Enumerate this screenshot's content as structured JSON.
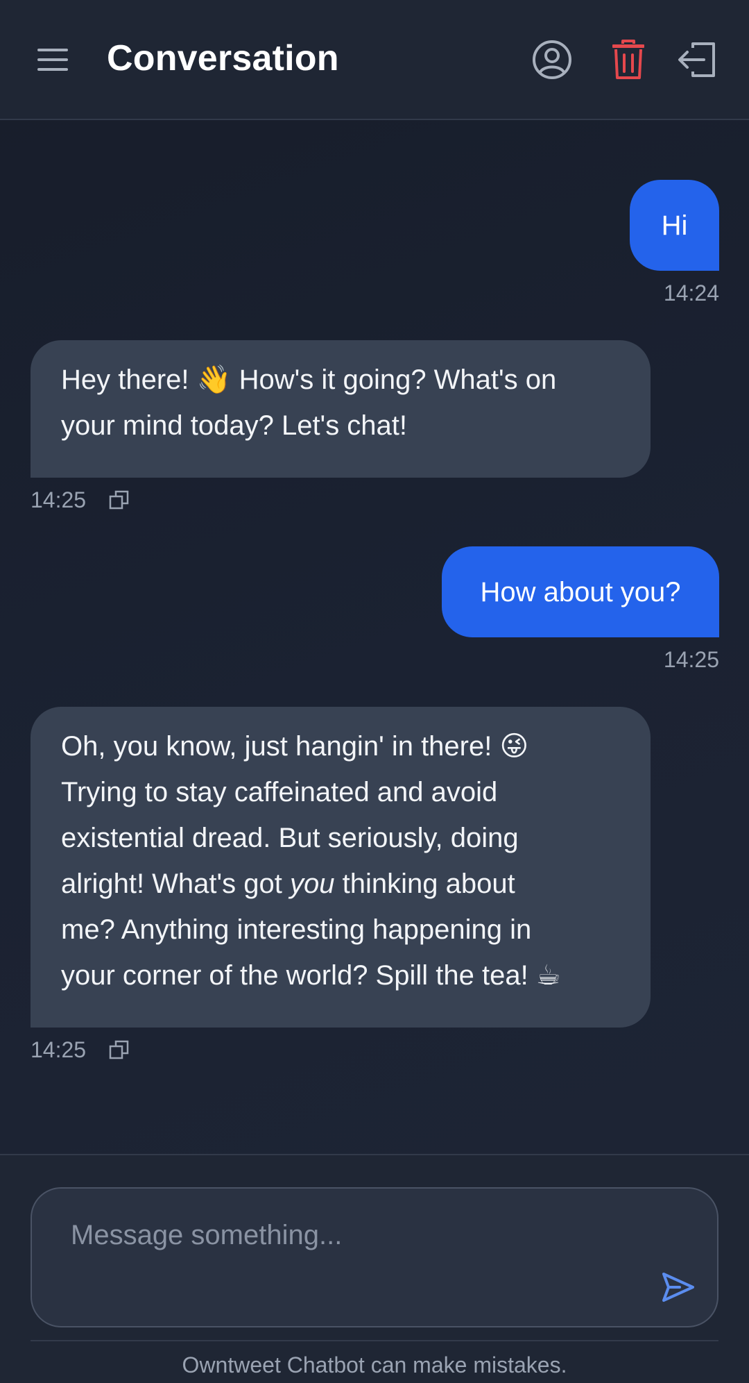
{
  "header": {
    "title": "Conversation",
    "icons": {
      "menu": "hamburger-menu-icon",
      "profile": "user-circle-icon",
      "delete": "trash-icon",
      "logout": "logout-icon"
    },
    "colors": {
      "delete": "#e5484d",
      "icon": "#a8b0bd"
    }
  },
  "messages": [
    {
      "role": "user",
      "text": "Hi",
      "time": "14:24"
    },
    {
      "role": "assistant",
      "lines": [
        "Hey there! 👋 How's it going? What's on",
        "your mind today? Let's chat!"
      ],
      "time": "14:25"
    },
    {
      "role": "user",
      "text": "How about you?",
      "time": "14:25"
    },
    {
      "role": "assistant",
      "lines_before": [
        "Oh, you know, just hangin' in there! 😜",
        "Trying to stay caffeinated and avoid",
        "existential dread. But seriously, doing"
      ],
      "line_emphasis_pre": "alright! What's got ",
      "line_emphasis_word": "you",
      "line_emphasis_post": " thinking about",
      "lines_after": [
        "me? Anything interesting happening in",
        "your corner of the world? Spill the tea! ☕"
      ],
      "time": "14:25"
    }
  ],
  "composer": {
    "placeholder": "Message something...",
    "value": "",
    "send_icon": "send-icon"
  },
  "disclaimer": "Owntweet Chatbot can make mistakes.",
  "colors": {
    "user_bubble": "#2463eb",
    "assistant_bubble": "#384253",
    "background": "#1a2030",
    "accent": "#5b8def"
  }
}
